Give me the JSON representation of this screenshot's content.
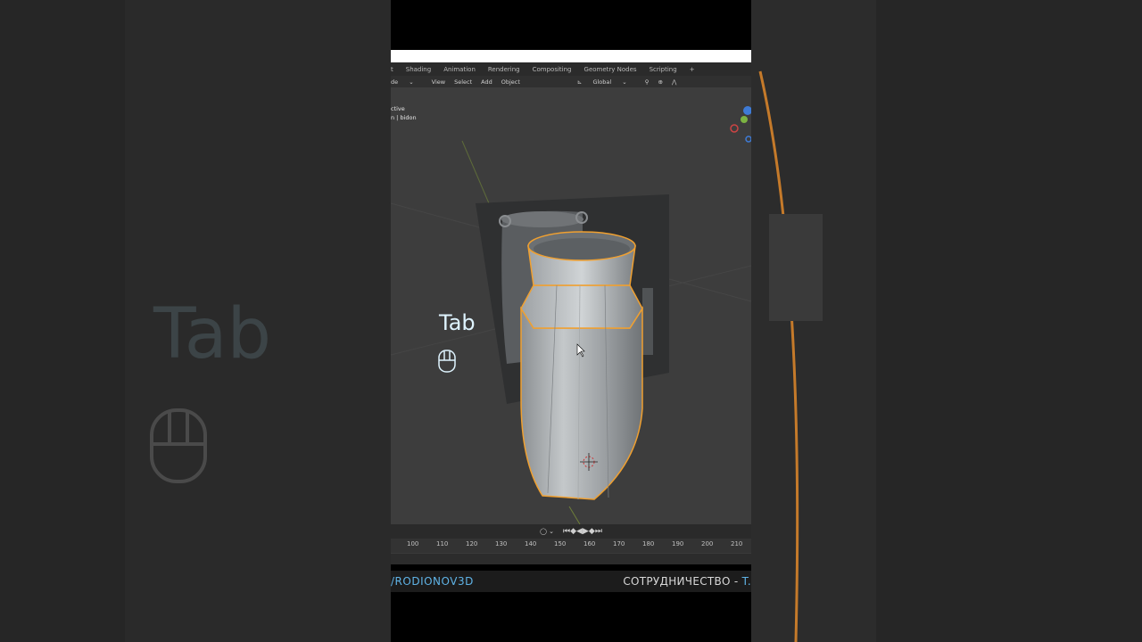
{
  "menu": {
    "tabs": [
      "t",
      "Shading",
      "Animation",
      "Rendering",
      "Compositing",
      "Geometry Nodes",
      "Scripting",
      "+"
    ]
  },
  "toolbar": {
    "mode": "de",
    "items": [
      "View",
      "Select",
      "Add",
      "Object"
    ],
    "transform": "Global"
  },
  "viewport": {
    "info_line1": "ctive",
    "info_line2": "n | bidon"
  },
  "overlay": {
    "key": "Tab",
    "ghost_key": "Tab"
  },
  "timeline": {
    "frames": [
      "100",
      "110",
      "120",
      "130",
      "140",
      "150",
      "160",
      "170",
      "180",
      "190",
      "200",
      "210"
    ]
  },
  "footer": {
    "left": "/RODIONOV3D",
    "right_prefix": "СОТРУДНИЧЕСТВО - ",
    "right_suffix": "T."
  },
  "colors": {
    "selection_outline": "#f0a030",
    "accent_blue": "#5fb3e6"
  },
  "icons": {
    "mouse": "mouse-icon",
    "playback": [
      "jump-start-icon",
      "prev-keyframe-icon",
      "play-reverse-icon",
      "play-icon",
      "next-keyframe-icon",
      "jump-end-icon"
    ]
  }
}
